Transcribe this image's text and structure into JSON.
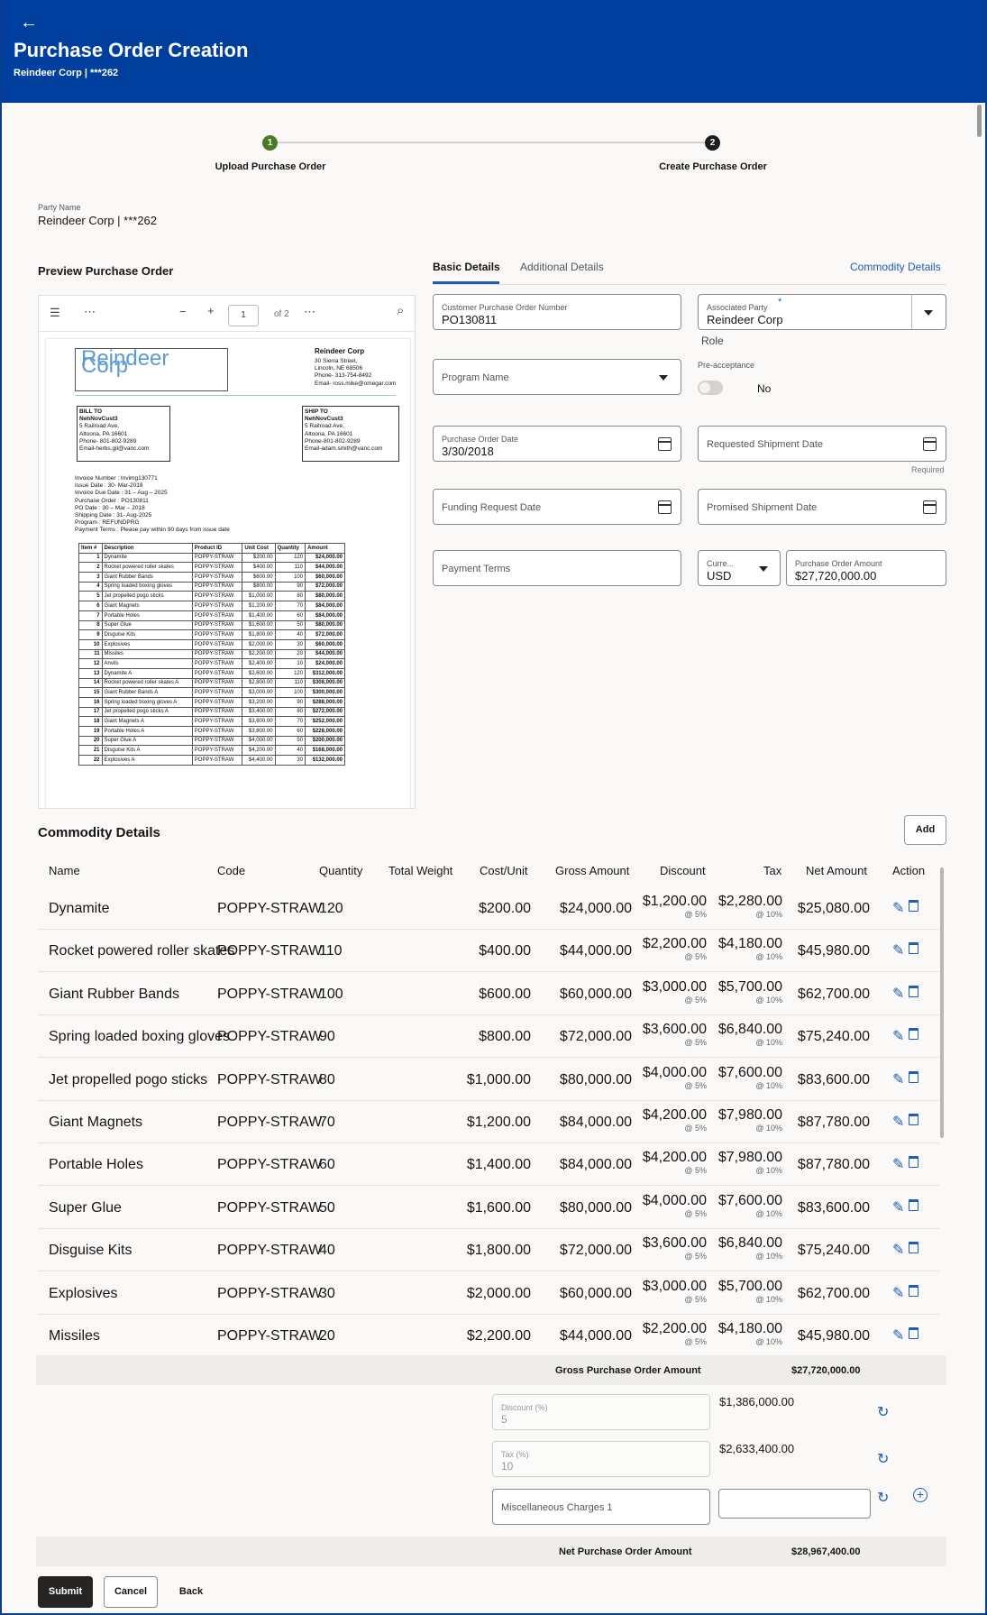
{
  "header": {
    "back_label": "←",
    "title": "Purchase Order Creation",
    "subtitle": "Reindeer Corp | ***262"
  },
  "steps": [
    {
      "num": "1",
      "label": "Upload Purchase Order",
      "color": "#4a7a26"
    },
    {
      "num": "2",
      "label": "Create Purchase Order",
      "color": "#1c1c1c"
    }
  ],
  "party": {
    "label": "Party Name",
    "value": "Reindeer Corp | ***262"
  },
  "preview": {
    "title": "Preview Purchase Order",
    "toolbar": {
      "menu": "☰",
      "more": "⋯",
      "minus": "−",
      "plus": "+",
      "page": "1",
      "of": "of 2",
      "more2": "⋯",
      "search": "⌕"
    },
    "doc": {
      "logo": "Reindeer Corp",
      "company": "Reindeer Corp",
      "addr": [
        "30 Sierra Street,",
        "Lincoln, NE 68506",
        "Phone- 313-754-8492",
        "Email- ross.mike@omegar.com"
      ],
      "bill_to": [
        "BILL TO",
        "NehNovCust3",
        "5 Railroad Ave,",
        "Altoona, PA 16601",
        "Phone- 801-802-9289",
        "Email-herbs.gil@vanc.com"
      ],
      "ship_to": [
        "SHIP TO",
        "NehNovCust3",
        "5 Railroad Ave,",
        "Altoona, PA 16601",
        "Phone-801-802-9289",
        "Email-adam.smith@vanc.com"
      ],
      "info": [
        "Invoice Number : Invimg130771",
        "Issue Date : 30- Mar-2018",
        "Invoice Due Date : 31 – Aug – 2025",
        "Purchase Order : PO130811",
        "PO Date : 30 – Mar – 2018",
        "Shipping Date : 31- Aug-2025",
        "Program : REFUNDPRG",
        "Payment Terms : Please pay within 90 days from issue date"
      ],
      "table_headers": [
        "Item #",
        "Description",
        "Product ID",
        "Unit Cost",
        "Quantity",
        "Amount"
      ],
      "rows": [
        [
          "1",
          "Dynamite",
          "POPPY-STRAW",
          "$200.00",
          "120",
          "$24,000.00"
        ],
        [
          "2",
          "Rocket powered roller skates",
          "POPPY-STRAW",
          "$400.00",
          "110",
          "$44,000.00"
        ],
        [
          "3",
          "Giant Rubber Bands",
          "POPPY-STRAW",
          "$600.00",
          "100",
          "$60,000.00"
        ],
        [
          "4",
          "Spring loaded boxing gloves",
          "POPPY-STRAW",
          "$800.00",
          "90",
          "$72,000.00"
        ],
        [
          "5",
          "Jet propelled pogo sticks",
          "POPPY-STRAW",
          "$1,000.00",
          "80",
          "$80,000.00"
        ],
        [
          "6",
          "Giant Magnets",
          "POPPY-STRAW",
          "$1,200.00",
          "70",
          "$84,000.00"
        ],
        [
          "7",
          "Portable Holes",
          "POPPY-STRAW",
          "$1,400.00",
          "60",
          "$84,000.00"
        ],
        [
          "8",
          "Super Glue",
          "POPPY-STRAW",
          "$1,600.00",
          "50",
          "$80,000.00"
        ],
        [
          "9",
          "Disguise Kits",
          "POPPY-STRAW",
          "$1,800.00",
          "40",
          "$72,000.00"
        ],
        [
          "10",
          "Explosives",
          "POPPY-STRAW",
          "$2,000.00",
          "30",
          "$60,000.00"
        ],
        [
          "11",
          "Missiles",
          "POPPY-STRAW",
          "$2,200.00",
          "20",
          "$44,000.00"
        ],
        [
          "12",
          "Anvils",
          "POPPY-STRAW",
          "$2,400.00",
          "10",
          "$24,000.00"
        ],
        [
          "13",
          "Dynamite A",
          "POPPY-STRAW",
          "$2,600.00",
          "120",
          "$312,000.00"
        ],
        [
          "14",
          "Rocket powered roller skates A",
          "POPPY-STRAW",
          "$2,800.00",
          "110",
          "$308,000.00"
        ],
        [
          "15",
          "Giant Rubber Bands A",
          "POPPY-STRAW",
          "$3,000.00",
          "100",
          "$300,000.00"
        ],
        [
          "16",
          "Spring loaded boxing gloves A",
          "POPPY-STRAW",
          "$3,200.00",
          "90",
          "$288,000.00"
        ],
        [
          "17",
          "Jet propelled pogo sticks A",
          "POPPY-STRAW",
          "$3,400.00",
          "80",
          "$272,000.00"
        ],
        [
          "18",
          "Giant Magnets A",
          "POPPY-STRAW",
          "$3,600.00",
          "70",
          "$252,000.00"
        ],
        [
          "19",
          "Portable Holes A",
          "POPPY-STRAW",
          "$3,800.00",
          "60",
          "$228,000.00"
        ],
        [
          "20",
          "Super Glue A",
          "POPPY-STRAW",
          "$4,000.00",
          "50",
          "$200,000.00"
        ],
        [
          "21",
          "Disguise Kits A",
          "POPPY-STRAW",
          "$4,200.00",
          "40",
          "$168,000.00"
        ],
        [
          "22",
          "Explosives A",
          "POPPY-STRAW",
          "$4,400.00",
          "30",
          "$132,000.00"
        ]
      ]
    }
  },
  "tabs": {
    "basic": "Basic Details",
    "additional": "Additional Details",
    "commodity": "Commodity Details"
  },
  "form": {
    "cpo_label": "Customer Purchase Order Number",
    "cpo_value": "PO130811",
    "assoc_label": "Associated Party",
    "assoc_req": "*",
    "assoc_value": "Reindeer Corp",
    "role": "Role",
    "program": "Program Name",
    "preaccept_label": "Pre-acceptance",
    "preaccept_value": "No",
    "po_date_label": "Purchase Order Date",
    "po_date_value": "3/30/2018",
    "req_ship": "Requested Shipment Date",
    "required": "Required",
    "funding": "Funding Request Date",
    "promised": "Promised Shipment Date",
    "payment": "Payment Terms",
    "currency_label": "Curre...",
    "currency_value": "USD",
    "po_amount_label": "Purchase Order Amount",
    "po_amount_value": "$27,720,000.00"
  },
  "commodity": {
    "title": "Commodity Details",
    "add": "Add",
    "headers": [
      "Name",
      "Code",
      "Quantity",
      "Total Weight",
      "Cost/Unit",
      "Gross Amount",
      "Discount",
      "Tax",
      "Net Amount",
      "Action"
    ],
    "rows": [
      {
        "name": "Dynamite",
        "code": "POPPY-STRAW",
        "qty": "120",
        "cost": "$200.00",
        "gross": "$24,000.00",
        "disc": "$1,200.00",
        "disc_r": "@ 5%",
        "tax": "$2,280.00",
        "tax_r": "@ 10%",
        "net": "$25,080.00"
      },
      {
        "name": "Rocket powered roller skates",
        "code": "POPPY-STRAW",
        "qty": "110",
        "cost": "$400.00",
        "gross": "$44,000.00",
        "disc": "$2,200.00",
        "disc_r": "@ 5%",
        "tax": "$4,180.00",
        "tax_r": "@ 10%",
        "net": "$45,980.00"
      },
      {
        "name": "Giant Rubber Bands",
        "code": "POPPY-STRAW",
        "qty": "100",
        "cost": "$600.00",
        "gross": "$60,000.00",
        "disc": "$3,000.00",
        "disc_r": "@ 5%",
        "tax": "$5,700.00",
        "tax_r": "@ 10%",
        "net": "$62,700.00"
      },
      {
        "name": "Spring loaded boxing gloves",
        "code": "POPPY-STRAW",
        "qty": "90",
        "cost": "$800.00",
        "gross": "$72,000.00",
        "disc": "$3,600.00",
        "disc_r": "@ 5%",
        "tax": "$6,840.00",
        "tax_r": "@ 10%",
        "net": "$75,240.00"
      },
      {
        "name": "Jet propelled pogo sticks",
        "code": "POPPY-STRAW",
        "qty": "80",
        "cost": "$1,000.00",
        "gross": "$80,000.00",
        "disc": "$4,000.00",
        "disc_r": "@ 5%",
        "tax": "$7,600.00",
        "tax_r": "@ 10%",
        "net": "$83,600.00"
      },
      {
        "name": "Giant Magnets",
        "code": "POPPY-STRAW",
        "qty": "70",
        "cost": "$1,200.00",
        "gross": "$84,000.00",
        "disc": "$4,200.00",
        "disc_r": "@ 5%",
        "tax": "$7,980.00",
        "tax_r": "@ 10%",
        "net": "$87,780.00"
      },
      {
        "name": "Portable Holes",
        "code": "POPPY-STRAW",
        "qty": "60",
        "cost": "$1,400.00",
        "gross": "$84,000.00",
        "disc": "$4,200.00",
        "disc_r": "@ 5%",
        "tax": "$7,980.00",
        "tax_r": "@ 10%",
        "net": "$87,780.00"
      },
      {
        "name": "Super Glue",
        "code": "POPPY-STRAW",
        "qty": "50",
        "cost": "$1,600.00",
        "gross": "$80,000.00",
        "disc": "$4,000.00",
        "disc_r": "@ 5%",
        "tax": "$7,600.00",
        "tax_r": "@ 10%",
        "net": "$83,600.00"
      },
      {
        "name": "Disguise Kits",
        "code": "POPPY-STRAW",
        "qty": "40",
        "cost": "$1,800.00",
        "gross": "$72,000.00",
        "disc": "$3,600.00",
        "disc_r": "@ 5%",
        "tax": "$6,840.00",
        "tax_r": "@ 10%",
        "net": "$75,240.00"
      },
      {
        "name": "Explosives",
        "code": "POPPY-STRAW",
        "qty": "30",
        "cost": "$2,000.00",
        "gross": "$60,000.00",
        "disc": "$3,000.00",
        "disc_r": "@ 5%",
        "tax": "$5,700.00",
        "tax_r": "@ 10%",
        "net": "$62,700.00"
      },
      {
        "name": "Missiles",
        "code": "POPPY-STRAW",
        "qty": "20",
        "cost": "$2,200.00",
        "gross": "$44,000.00",
        "disc": "$2,200.00",
        "disc_r": "@ 5%",
        "tax": "$4,180.00",
        "tax_r": "@ 10%",
        "net": "$45,980.00"
      }
    ]
  },
  "summary": {
    "gross_label": "Gross Purchase Order Amount",
    "gross_value": "$27,720,000.00",
    "disc_label": "Discount (%)",
    "disc_value": "5",
    "disc_amount": "$1,386,000.00",
    "tax_label": "Tax (%)",
    "tax_value": "10",
    "tax_amount": "$2,633,400.00",
    "misc_label": "Miscellaneous Charges 1",
    "misc_value": "",
    "net_label": "Net Purchase Order Amount",
    "net_value": "$28,967,400.00"
  },
  "actions": {
    "submit": "Submit",
    "cancel": "Cancel",
    "back": "Back"
  },
  "colors": {
    "header": "#003f9e",
    "link": "#1a5fb4",
    "accent": "#4a7a26"
  }
}
